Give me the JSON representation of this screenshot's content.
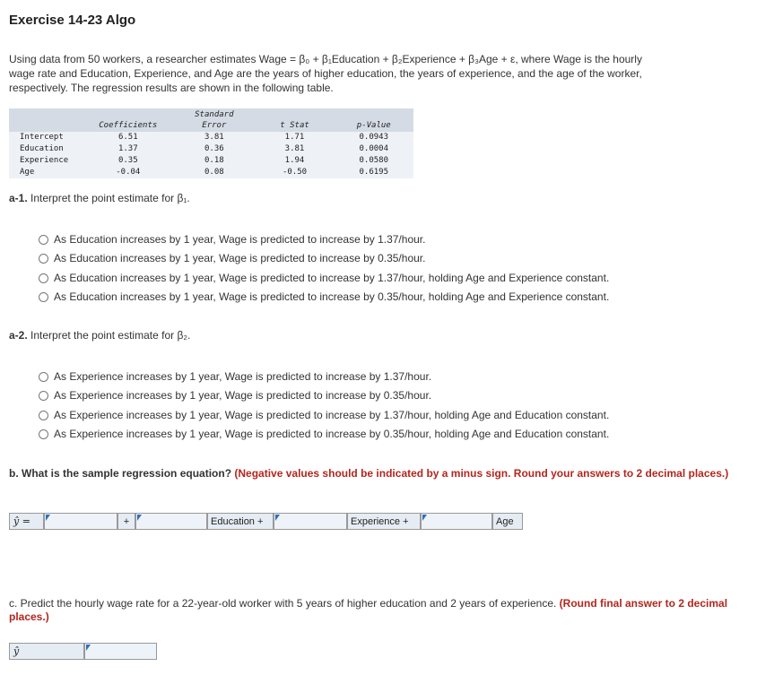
{
  "title": "Exercise 14-23 Algo",
  "intro": {
    "line1": "Using data from 50 workers, a researcher estimates Wage = β₀ + β₁Education + β₂Experience + β₃Age + ε, where Wage is the hourly",
    "line2": "wage rate and Education, Experience, and Age are the years of higher education, the years of experience, and the age of the worker,",
    "line3": "respectively. The regression results are shown in the following table."
  },
  "table": {
    "headers": [
      "",
      "Coefficients",
      "Standard Error",
      "t Stat",
      "p-Value"
    ],
    "rows": [
      [
        "Intercept",
        "6.51",
        "3.81",
        "1.71",
        "0.0943"
      ],
      [
        "Education",
        "1.37",
        "0.36",
        "3.81",
        "0.0004"
      ],
      [
        "Experience",
        "0.35",
        "0.18",
        "1.94",
        "0.0580"
      ],
      [
        "Age",
        "-0.04",
        "0.08",
        "-0.50",
        "0.6195"
      ]
    ]
  },
  "a1": {
    "label": "a-1.",
    "question": "Interpret the point estimate for β₁.",
    "options": [
      "As Education increases by 1 year, Wage is predicted to increase by 1.37/hour.",
      "As Education increases by 1 year, Wage is predicted to increase by 0.35/hour.",
      "As Education increases by 1 year, Wage is predicted to increase by 1.37/hour, holding Age and Experience constant.",
      "As Education increases by 1 year, Wage is predicted to increase by 0.35/hour, holding Age and Experience constant."
    ]
  },
  "a2": {
    "label": "a-2.",
    "question": "Interpret the point estimate for β₂.",
    "options": [
      "As Experience increases by 1 year, Wage is predicted to increase by 1.37/hour.",
      "As Experience increases by 1 year, Wage is predicted to increase by 0.35/hour.",
      "As Experience increases by 1 year, Wage is predicted to increase by 1.37/hour, holding Age and Education constant.",
      "As Experience increases by 1 year, Wage is predicted to increase by 0.35/hour, holding Age and Education constant."
    ]
  },
  "b": {
    "question": "b. What is the sample regression equation?",
    "instruction": "(Negative values should be indicated by a minus sign. Round your answers to 2 decimal places.)",
    "yhat_label": "ŷ =",
    "plus": "+",
    "education_label": "Education +",
    "experience_label": "Experience +",
    "age_label": "Age"
  },
  "c": {
    "question": "c. Predict the hourly wage rate for a 22-year-old worker with 5 years of higher education and 2 years of experience.",
    "instruction": "(Round final answer to 2 decimal places.)",
    "yhat_label": "ŷ"
  },
  "colors": {
    "instruction_red": "#b3261e",
    "input_flag": "#2c6fbb",
    "table_header": "#d4dbe4"
  }
}
